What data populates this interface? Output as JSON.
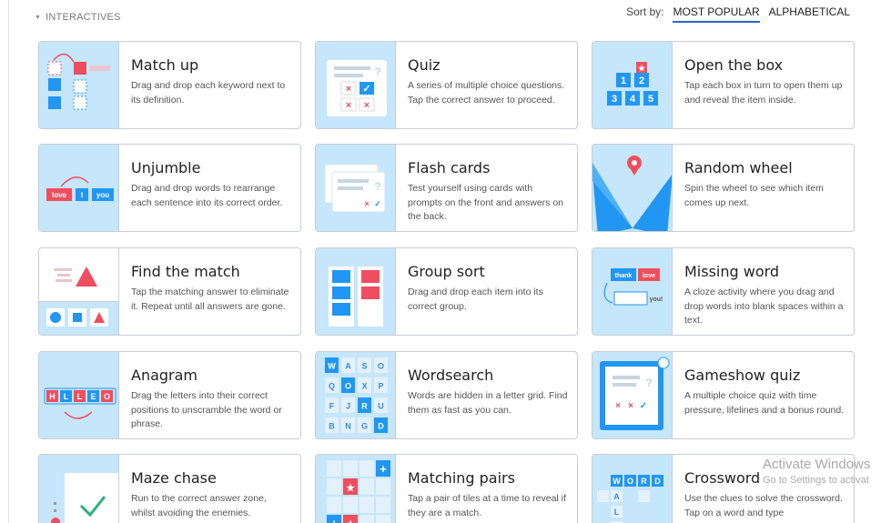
{
  "section_label": "INTERACTIVES",
  "sort": {
    "label": "Sort by:",
    "options": [
      "MOST POPULAR",
      "ALPHABETICAL"
    ],
    "active": "MOST POPULAR"
  },
  "cards": [
    {
      "title": "Match up",
      "desc": "Drag and drop each keyword next to its definition.",
      "icon": "match-up-icon"
    },
    {
      "title": "Quiz",
      "desc": "A series of multiple choice questions. Tap the correct answer to proceed.",
      "icon": "quiz-icon"
    },
    {
      "title": "Open the box",
      "desc": "Tap each box in turn to open them up and reveal the item inside.",
      "icon": "open-the-box-icon"
    },
    {
      "title": "Unjumble",
      "desc": "Drag and drop words to rearrange each sentence into its correct order.",
      "icon": "unjumble-icon",
      "words": [
        "love",
        "I",
        "you"
      ]
    },
    {
      "title": "Flash cards",
      "desc": "Test yourself using cards with prompts on the front and answers on the back.",
      "icon": "flash-cards-icon"
    },
    {
      "title": "Random wheel",
      "desc": "Spin the wheel to see which item comes up next.",
      "icon": "random-wheel-icon"
    },
    {
      "title": "Find the match",
      "desc": "Tap the matching answer to eliminate it. Repeat until all answers are gone.",
      "icon": "find-the-match-icon"
    },
    {
      "title": "Group sort",
      "desc": "Drag and drop each item into its correct group.",
      "icon": "group-sort-icon"
    },
    {
      "title": "Missing word",
      "desc": "A cloze activity where you drag and drop words into blank spaces within a text.",
      "icon": "missing-word-icon",
      "words": [
        "thank",
        "love",
        "you!"
      ]
    },
    {
      "title": "Anagram",
      "desc": "Drag the letters into their correct positions to unscramble the word or phrase.",
      "icon": "anagram-icon",
      "letters": [
        "H",
        "L",
        "L",
        "E",
        "O"
      ]
    },
    {
      "title": "Wordsearch",
      "desc": "Words are hidden in a letter grid. Find them as fast as you can.",
      "icon": "wordsearch-icon",
      "letters": [
        "W",
        "A",
        "S",
        "O",
        "Q",
        "O",
        "X",
        "P",
        "F",
        "J",
        "R",
        "U",
        "B",
        "N",
        "G",
        "D"
      ]
    },
    {
      "title": "Gameshow quiz",
      "desc": "A multiple choice quiz with time pressure, lifelines and a bonus round.",
      "icon": "gameshow-quiz-icon"
    },
    {
      "title": "Maze chase",
      "desc": "Run to the correct answer zone, whilst avoiding the enemies.",
      "icon": "maze-chase-icon"
    },
    {
      "title": "Matching pairs",
      "desc": "Tap a pair of tiles at a time to reveal if they are a match.",
      "icon": "matching-pairs-icon"
    },
    {
      "title": "Crossword",
      "desc": "Use the clues to solve the crossword. Tap on a word and type",
      "icon": "crossword-icon",
      "letters": [
        "W",
        "O",
        "R",
        "D",
        "A",
        "L"
      ]
    }
  ],
  "open_box_numbers": [
    "1",
    "2",
    "3",
    "4",
    "5"
  ],
  "watermark": {
    "line1": "Activate Windows",
    "line2": "Go to Settings to activat"
  },
  "colors": {
    "thumb_bg": "#c6e6fb",
    "blue": "#2196f3",
    "red": "#f04e5e",
    "accent": "#2a66c8"
  }
}
